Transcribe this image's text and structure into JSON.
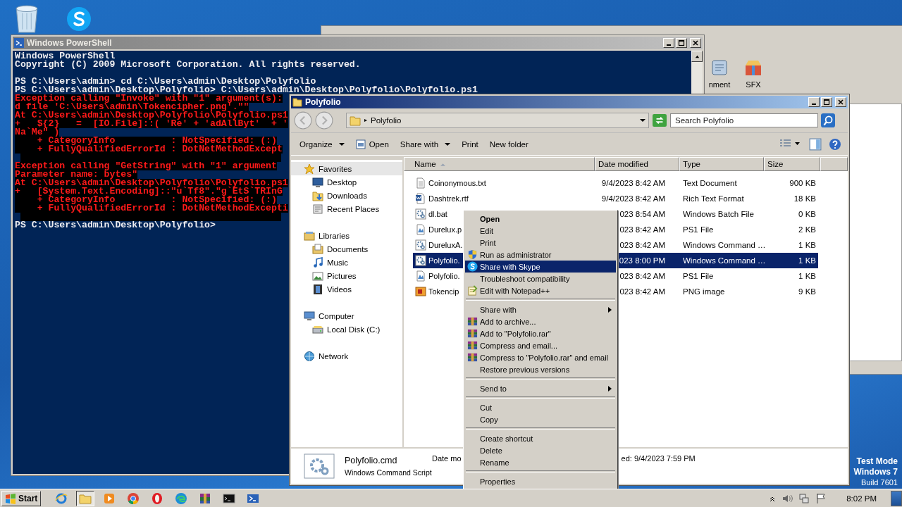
{
  "desktop": {
    "icons": [
      {
        "kind": "recycle_bin"
      },
      {
        "kind": "skype"
      }
    ],
    "build_info": [
      "Test Mode",
      "Windows 7",
      "Build 7601"
    ]
  },
  "background_window": {
    "toolbar": [
      {
        "label": "nment",
        "kind": "comment"
      },
      {
        "label": "SFX",
        "kind": "sfx"
      }
    ]
  },
  "powershell": {
    "title": "Windows PowerShell",
    "lines": [
      {
        "kind": "normal",
        "text": "Windows PowerShell"
      },
      {
        "kind": "normal",
        "text": "Copyright (C) 2009 Microsoft Corporation. All rights reserved."
      },
      {
        "kind": "blank"
      },
      {
        "kind": "normal",
        "text": "PS C:\\Users\\admin> cd C:\\Users\\admin\\Desktop\\Polyfolio"
      },
      {
        "kind": "normal",
        "text": "PS C:\\Users\\admin\\Desktop\\Polyfolio> C:\\Users\\admin\\Desktop\\Polyfolio\\Polyfolio.ps1"
      },
      {
        "kind": "error",
        "text": "Exception calling \"Invoke\" with \"1\" argument(s):"
      },
      {
        "kind": "error",
        "text": "d file 'C:\\Users\\admin\\Tokencipher.png'.\"\""
      },
      {
        "kind": "error",
        "text": "At C:\\Users\\admin\\Desktop\\Polyfolio\\Polyfolio.ps1"
      },
      {
        "kind": "error",
        "text": "+   ${2}   =  [IO.File]::( 'Re' + 'adAllByt'  + '"
      },
      {
        "kind": "error",
        "text": "Na`Me\" )"
      },
      {
        "kind": "error",
        "text": "    + CategoryInfo          : NotSpecified: (:)"
      },
      {
        "kind": "error",
        "text": "    + FullyQualifiedErrorId : DotNetMethodExcept"
      },
      {
        "kind": "error_blank"
      },
      {
        "kind": "error",
        "text": "Exception calling \"GetString\" with \"1\" argument"
      },
      {
        "kind": "error",
        "text": "Parameter name: bytes\""
      },
      {
        "kind": "error",
        "text": "At C:\\Users\\admin\\Desktop\\Polyfolio\\Polyfolio.ps1"
      },
      {
        "kind": "error",
        "text": "+   [System.Text.Encoding]::\"u`Tf8\".\"g`EtS`TRInG"
      },
      {
        "kind": "error",
        "text": "    + CategoryInfo          : NotSpecified: (:)"
      },
      {
        "kind": "error",
        "text": "    + FullyQualifiedErrorId : DotNetMethodExcepti"
      },
      {
        "kind": "error_blank"
      },
      {
        "kind": "normal",
        "text": "PS C:\\Users\\admin\\Desktop\\Polyfolio>"
      }
    ]
  },
  "explorer": {
    "title": "Polyfolio",
    "address": "Polyfolio",
    "search": {
      "placeholder": "Search Polyfolio"
    },
    "toolbar": [
      {
        "label": "Organize",
        "kind": "dropdown"
      },
      {
        "label": "Open",
        "kind": "icon"
      },
      {
        "label": "Share with",
        "kind": "dropdown"
      },
      {
        "label": "Print",
        "kind": "plain"
      },
      {
        "label": "New folder",
        "kind": "plain"
      }
    ],
    "nav": [
      {
        "label": "Favorites",
        "kind": "star",
        "selected": true,
        "children": [
          {
            "label": "Desktop",
            "kind": "desktop",
            "selected": false
          },
          {
            "label": "Downloads",
            "kind": "downloads",
            "selected": false
          },
          {
            "label": "Recent Places",
            "kind": "recent",
            "selected": false
          }
        ]
      },
      {
        "label": "Libraries",
        "kind": "libraries",
        "selected": false,
        "children": [
          {
            "label": "Documents",
            "kind": "documents",
            "selected": false
          },
          {
            "label": "Music",
            "kind": "music",
            "selected": false
          },
          {
            "label": "Pictures",
            "kind": "pictures",
            "selected": false
          },
          {
            "label": "Videos",
            "kind": "videos",
            "selected": false
          }
        ]
      },
      {
        "label": "Computer",
        "kind": "computer",
        "selected": false,
        "children": [
          {
            "label": "Local Disk (C:)",
            "kind": "disk",
            "selected": false
          }
        ]
      },
      {
        "label": "Network",
        "kind": "network",
        "selected": false
      }
    ],
    "columns": [
      {
        "label": "Name",
        "sorted": true
      },
      {
        "label": "Date modified",
        "sorted": false
      },
      {
        "label": "Type",
        "sorted": false
      },
      {
        "label": "Size",
        "sorted": false
      }
    ],
    "files": [
      {
        "name": "Coinonymous.txt",
        "date": "9/4/2023 8:42 AM",
        "type": "Text Document",
        "size": "900 KB",
        "kind": "text",
        "selected": false
      },
      {
        "name": "Dashtrek.rtf",
        "date": "9/4/2023 8:42 AM",
        "type": "Rich Text Format",
        "size": "18 KB",
        "kind": "rtf",
        "selected": false
      },
      {
        "name": "dl.bat",
        "date": "023 8:54 AM",
        "type": "Windows Batch File",
        "size": "0 KB",
        "kind": "script",
        "selected": false
      },
      {
        "name": "Durelux.p",
        "date": "023 8:42 AM",
        "type": "PS1 File",
        "size": "2 KB",
        "kind": "ps1",
        "selected": false
      },
      {
        "name": "DureluxA.",
        "date": "023 8:42 AM",
        "type": "Windows Command …",
        "size": "1 KB",
        "kind": "script",
        "selected": false
      },
      {
        "name": "Polyfolio.",
        "date": "023 8:00 PM",
        "type": "Windows Command …",
        "size": "1 KB",
        "kind": "script",
        "selected": true
      },
      {
        "name": "Polyfolio.",
        "date": "023 8:42 AM",
        "type": "PS1 File",
        "size": "1 KB",
        "kind": "ps1",
        "selected": false
      },
      {
        "name": "Tokencip",
        "date": "023 8:42 AM",
        "type": "PNG image",
        "size": "9 KB",
        "kind": "image",
        "selected": false
      }
    ],
    "details": {
      "name": "Polyfolio.cmd",
      "type": "Windows Command Script",
      "date_label": "Date mo",
      "created": "ed: 9/4/2023 7:59 PM"
    }
  },
  "context_menu": {
    "items": [
      {
        "kind": "plain",
        "label": "Open",
        "bold": true,
        "selected": false,
        "submenu": false
      },
      {
        "kind": "plain",
        "label": "Edit",
        "bold": false,
        "selected": false,
        "submenu": false
      },
      {
        "kind": "plain",
        "label": "Print",
        "bold": false,
        "selected": false,
        "submenu": false
      },
      {
        "kind": "shield",
        "label": "Run as administrator",
        "bold": false,
        "selected": false,
        "submenu": false
      },
      {
        "kind": "skype",
        "label": "Share with Skype",
        "bold": false,
        "selected": true,
        "submenu": false
      },
      {
        "kind": "plain",
        "label": "Troubleshoot compatibility",
        "bold": false,
        "selected": false,
        "submenu": false
      },
      {
        "kind": "notepad",
        "label": "Edit with Notepad++",
        "bold": false,
        "selected": false,
        "submenu": false
      },
      {
        "kind": "separator"
      },
      {
        "kind": "plain",
        "label": "Share with",
        "bold": false,
        "selected": false,
        "submenu": true
      },
      {
        "kind": "archive",
        "label": "Add to archive...",
        "bold": false,
        "selected": false,
        "submenu": false
      },
      {
        "kind": "archive",
        "label": "Add to \"Polyfolio.rar\"",
        "bold": false,
        "selected": false,
        "submenu": false
      },
      {
        "kind": "archive",
        "label": "Compress and email...",
        "bold": false,
        "selected": false,
        "submenu": false
      },
      {
        "kind": "archive",
        "label": "Compress to \"Polyfolio.rar\" and email",
        "bold": false,
        "selected": false,
        "submenu": false
      },
      {
        "kind": "plain",
        "label": "Restore previous versions",
        "bold": false,
        "selected": false,
        "submenu": false
      },
      {
        "kind": "separator"
      },
      {
        "kind": "plain",
        "label": "Send to",
        "bold": false,
        "selected": false,
        "submenu": true
      },
      {
        "kind": "separator"
      },
      {
        "kind": "plain",
        "label": "Cut",
        "bold": false,
        "selected": false,
        "submenu": false
      },
      {
        "kind": "plain",
        "label": "Copy",
        "bold": false,
        "selected": false,
        "submenu": false
      },
      {
        "kind": "separator"
      },
      {
        "kind": "plain",
        "label": "Create shortcut",
        "bold": false,
        "selected": false,
        "submenu": false
      },
      {
        "kind": "plain",
        "label": "Delete",
        "bold": false,
        "selected": false,
        "submenu": false
      },
      {
        "kind": "plain",
        "label": "Rename",
        "bold": false,
        "selected": false,
        "submenu": false
      },
      {
        "kind": "separator"
      },
      {
        "kind": "plain",
        "label": "Properties",
        "bold": false,
        "selected": false,
        "submenu": false
      }
    ]
  },
  "taskbar": {
    "start": "Start",
    "apps": [
      {
        "kind": "ie",
        "selected": false
      },
      {
        "kind": "explorer",
        "selected": true
      },
      {
        "kind": "media",
        "selected": false
      },
      {
        "kind": "chrome",
        "selected": false
      },
      {
        "kind": "opera",
        "selected": false
      },
      {
        "kind": "edge",
        "selected": false
      },
      {
        "kind": "winrar",
        "selected": false
      },
      {
        "kind": "cmd",
        "selected": false
      },
      {
        "kind": "powershell",
        "selected": false
      }
    ],
    "clock": "8:02 PM"
  }
}
